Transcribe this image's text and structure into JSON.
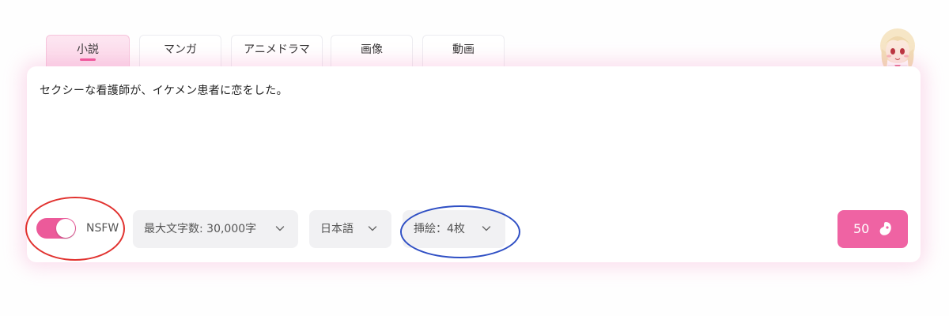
{
  "tabs": [
    {
      "label": "小説",
      "active": true
    },
    {
      "label": "マンガ",
      "active": false
    },
    {
      "label": "アニメドラマ",
      "active": false
    },
    {
      "label": "画像",
      "active": false
    },
    {
      "label": "動画",
      "active": false
    }
  ],
  "prompt": {
    "text": "セクシーな看護師が、イケメン患者に恋をした。"
  },
  "controls": {
    "nsfw_toggle_on": true,
    "nsfw_label": "NSFW",
    "max_chars_label": "最大文字数: 30,000字",
    "language_label": "日本語",
    "illustrations_label": "挿絵：4枚"
  },
  "submit": {
    "credits": "50",
    "icon": "bean-icon"
  },
  "colors": {
    "accent": "#ef63a3",
    "toggle_on": "#ec5a9a",
    "highlight_red": "#e1322f",
    "highlight_blue": "#2f4fc4"
  }
}
